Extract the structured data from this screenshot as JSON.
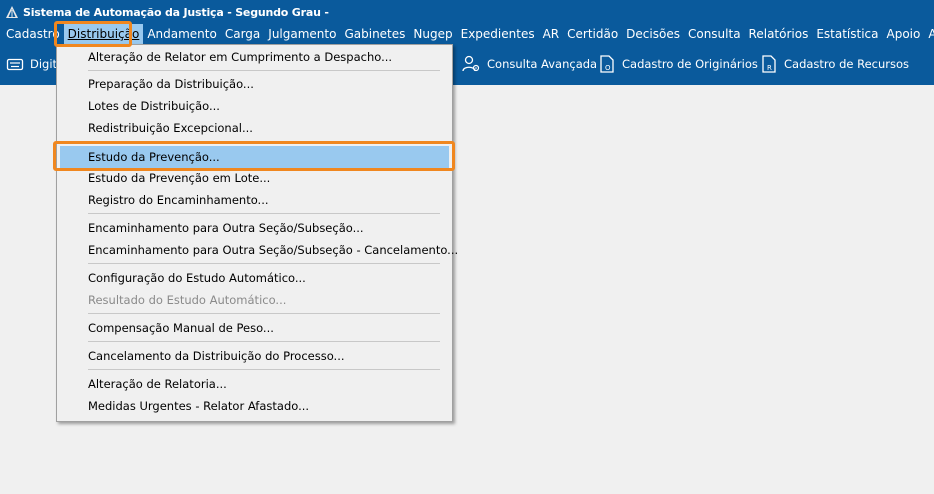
{
  "window": {
    "title": "Sistema de Automação da Justiça - Segundo Grau -"
  },
  "menubar": {
    "items": [
      {
        "label": "Cadastro"
      },
      {
        "label": "Distribuição"
      },
      {
        "label": "Andamento"
      },
      {
        "label": "Carga"
      },
      {
        "label": "Julgamento"
      },
      {
        "label": "Gabinetes"
      },
      {
        "label": "Nugep"
      },
      {
        "label": "Expedientes"
      },
      {
        "label": "AR"
      },
      {
        "label": "Certidão"
      },
      {
        "label": "Decisões"
      },
      {
        "label": "Consulta"
      },
      {
        "label": "Relatórios"
      },
      {
        "label": "Estatística"
      },
      {
        "label": "Apoio"
      },
      {
        "label": "Ajuda"
      }
    ]
  },
  "toolbar": {
    "digit_label": "Digit",
    "consulta_avancada": "Consulta Avançada",
    "cadastro_originarios": "Cadastro de Originários",
    "cadastro_recursos": "Cadastro de Recursos"
  },
  "dropdown": {
    "items": [
      {
        "label": "Alteração de Relator em Cumprimento a Despacho..."
      },
      {
        "label": "Preparação da Distribuição..."
      },
      {
        "label": "Lotes de Distribuição..."
      },
      {
        "label": "Redistribuição Excepcional..."
      },
      {
        "label": "Estudo da Prevenção..."
      },
      {
        "label": "Estudo da Prevenção em Lote..."
      },
      {
        "label": "Registro do Encaminhamento..."
      },
      {
        "label": "Encaminhamento para Outra Seção/Subseção..."
      },
      {
        "label": "Encaminhamento para Outra Seção/Subseção - Cancelamento..."
      },
      {
        "label": "Configuração do Estudo Automático..."
      },
      {
        "label": "Resultado do Estudo Automático..."
      },
      {
        "label": "Compensação Manual de Peso..."
      },
      {
        "label": "Cancelamento da Distribuição do Processo..."
      },
      {
        "label": "Alteração de Relatoria..."
      },
      {
        "label": "Medidas Urgentes - Relator Afastado..."
      }
    ]
  },
  "colors": {
    "titlebar_bg": "#0a5a9c",
    "menu_highlight": "#99c9ef",
    "annotation": "#f0871f"
  },
  "icons": [
    "app-logo-icon",
    "keyboard-icon",
    "user-gear-icon",
    "document-o-icon",
    "document-r-icon"
  ]
}
